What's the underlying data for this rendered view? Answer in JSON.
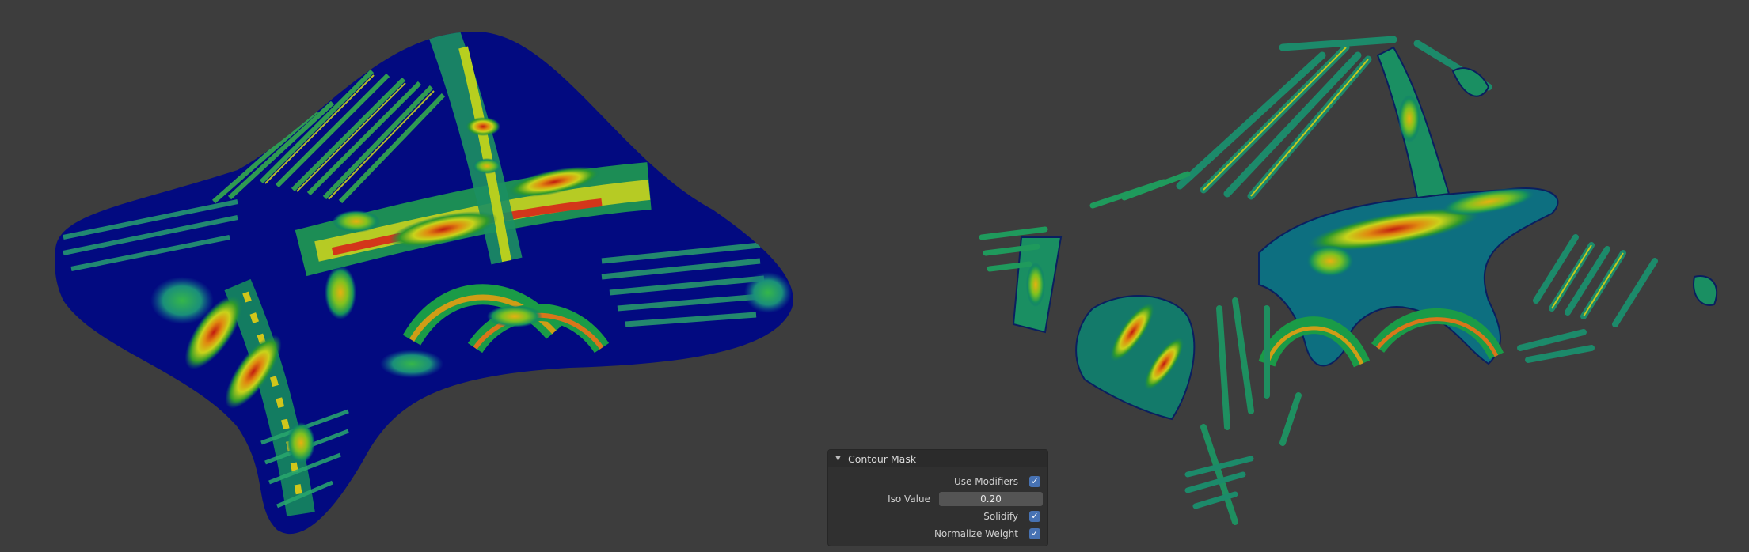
{
  "panel": {
    "title": "Contour Mask",
    "rows": {
      "use_modifiers": {
        "label": "Use Modifiers",
        "checked": true
      },
      "iso_value": {
        "label": "Iso Value",
        "value": "0.20"
      },
      "solidify": {
        "label": "Solidify",
        "checked": true
      },
      "normalize_weight": {
        "label": "Normalize Weight",
        "checked": true
      }
    }
  },
  "icons": {
    "collapse": "triangle-down-icon",
    "check": "checkmark-icon"
  },
  "colors": {
    "background": "#3d3d3d",
    "panel": "#303030",
    "accent": "#4772b3",
    "surface_low": "#000c82",
    "surface_mid": "#1a9641",
    "surface_high": "#d7191c"
  }
}
